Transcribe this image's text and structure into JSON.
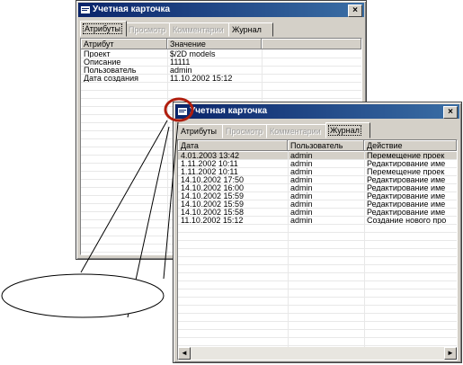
{
  "back": {
    "title": "Учетная карточка",
    "close": "×",
    "tabs": [
      "Атрибуты",
      "Просмотр",
      "Комментарии",
      "Журнал"
    ],
    "columns": [
      "Атрибут",
      "Значение"
    ],
    "rows": [
      [
        "Проект",
        "$/2D models"
      ],
      [
        "Описание",
        "11111"
      ],
      [
        "Пользователь",
        "admin"
      ],
      [
        "Дата создания",
        "11.10.2002 15:12"
      ]
    ]
  },
  "front": {
    "title": "Учетная карточка",
    "close": "×",
    "tabs": [
      "Атрибуты",
      "Просмотр",
      "Комментарии",
      "Журнал"
    ],
    "columns": [
      "Дата",
      "Пользователь",
      "Действие"
    ],
    "rows": [
      [
        "4.01.2003 13:42",
        "admin",
        "Перемещение проек"
      ],
      [
        "1.11.2002 10:11",
        "admin",
        "Редактирование име"
      ],
      [
        "1.11.2002 10:11",
        "admin",
        "Перемещение проек"
      ],
      [
        "14.10.2002 17:50",
        "admin",
        "Редактирование име"
      ],
      [
        "14.10.2002 16:00",
        "admin",
        "Редактирование име"
      ],
      [
        "14.10.2002 15:59",
        "admin",
        "Редактирование име"
      ],
      [
        "14.10.2002 15:59",
        "admin",
        "Редактирование име"
      ],
      [
        "14.10.2002 15:58",
        "admin",
        "Редактирование име"
      ],
      [
        "11.10.2002 15:12",
        "admin",
        "Создание нового про"
      ]
    ],
    "scroll_left": "◄",
    "scroll_right": "►"
  },
  "colors": {
    "titlebar": "#0a246a",
    "highlight_circle": "#b01e0e",
    "window": "#d4d0c8"
  },
  "icons": {
    "window_icon": "card-icon"
  }
}
